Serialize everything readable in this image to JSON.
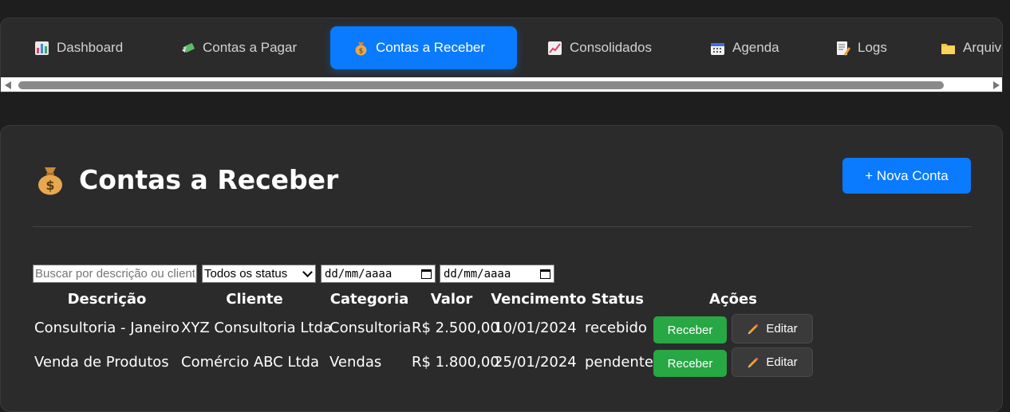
{
  "nav": {
    "tabs": [
      {
        "label": "Dashboard",
        "icon": "bar-chart-icon",
        "active": false
      },
      {
        "label": "Contas a Pagar",
        "icon": "money-with-wings-icon",
        "active": false
      },
      {
        "label": "Contas a Receber",
        "icon": "money-bag-icon",
        "active": true
      },
      {
        "label": "Consolidados",
        "icon": "chart-increasing-icon",
        "active": false
      },
      {
        "label": "Agenda",
        "icon": "calendar-icon",
        "active": false
      },
      {
        "label": "Logs",
        "icon": "memo-icon",
        "active": false
      },
      {
        "label": "Arquivos",
        "icon": "folder-icon",
        "active": false
      }
    ]
  },
  "page": {
    "title": "Contas a Receber",
    "title_icon": "money-bag-icon",
    "new_button": "+ Nova Conta"
  },
  "filters": {
    "search_placeholder": "Buscar por descrição ou cliente",
    "status_selected": "Todos os status",
    "date_from_placeholder": "dd/mm/aaaa",
    "date_to_placeholder": "dd/mm/aaaa"
  },
  "table": {
    "headers": [
      "Descrição",
      "Cliente",
      "Categoria",
      "Valor",
      "Vencimento",
      "Status",
      "Ações"
    ],
    "rows": [
      {
        "descricao": "Consultoria - Janeiro",
        "cliente": "XYZ Consultoria Ltda",
        "categoria": "Consultoria",
        "valor": "R$ 2.500,00",
        "vencimento": "10/01/2024",
        "status": "recebido"
      },
      {
        "descricao": "Venda de Produtos",
        "cliente": "Comércio ABC Ltda",
        "categoria": "Vendas",
        "valor": "R$ 1.800,00",
        "vencimento": "25/01/2024",
        "status": "pendente"
      }
    ],
    "receive_label": "Receber",
    "edit_label": "Editar"
  },
  "colors": {
    "accent": "#0a7aff",
    "success": "#28a745",
    "background": "#1e1e1e",
    "panel": "#2b2b2b"
  }
}
